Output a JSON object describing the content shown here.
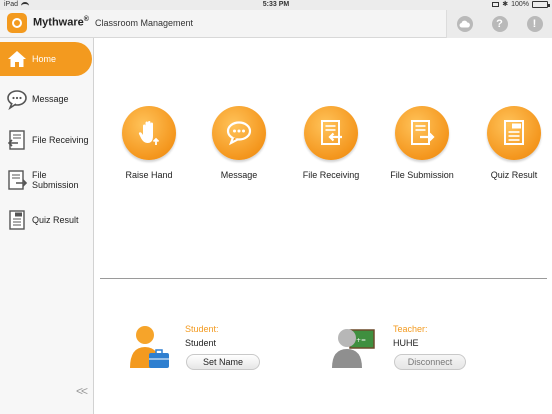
{
  "status_bar": {
    "carrier": "iPad",
    "time": "5:33 PM",
    "battery": "100%",
    "battery_level": 1.0
  },
  "header": {
    "brand": "Mythware",
    "brand_mark": "®",
    "subtitle": "Classroom Management",
    "icons": [
      "cloud-icon",
      "help-icon",
      "alert-icon"
    ],
    "help_glyph": "?",
    "alert_glyph": "!"
  },
  "sidebar": {
    "items": [
      {
        "label": "Home",
        "icon": "home-icon",
        "active": true
      },
      {
        "label": "Message",
        "icon": "message-icon",
        "active": false
      },
      {
        "label": "File Receiving",
        "icon": "file-receiving-icon",
        "active": false
      },
      {
        "label": "File\nSubmission",
        "icon": "file-submission-icon",
        "active": false
      },
      {
        "label": "Quiz Result",
        "icon": "quiz-result-icon",
        "active": false
      }
    ],
    "collapse_label": "<<"
  },
  "tiles": [
    {
      "label": "Raise Hand",
      "icon": "raise-hand-icon"
    },
    {
      "label": "Message",
      "icon": "message-icon"
    },
    {
      "label": "File Receiving",
      "icon": "file-receiving-icon"
    },
    {
      "label": "File Submission",
      "icon": "file-submission-icon"
    },
    {
      "label": "Quiz Result",
      "icon": "quiz-result-icon"
    }
  ],
  "student": {
    "role_label": "Student:",
    "name": "Student",
    "button_label": "Set Name"
  },
  "teacher": {
    "role_label": "Teacher:",
    "name": "HUHE",
    "button_label": "Disconnect"
  },
  "colors": {
    "accent": "#f39a1f",
    "sidebar_bg": "#f7f7f7",
    "header_bg": "#f4f4f4"
  }
}
